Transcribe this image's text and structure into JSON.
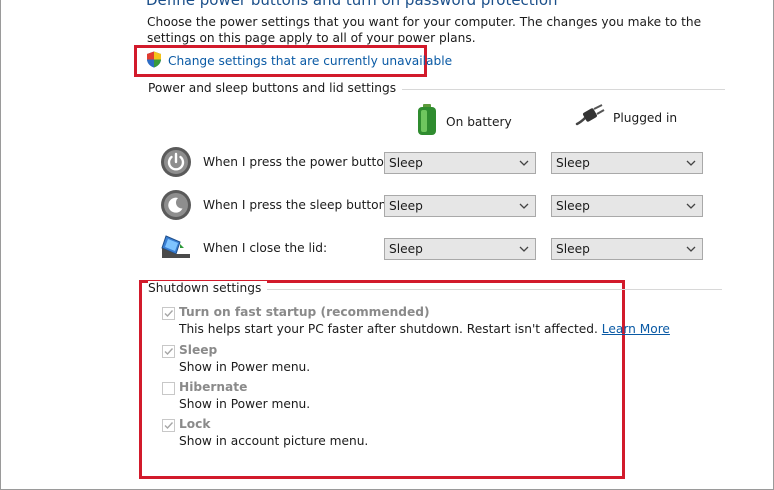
{
  "header": {
    "heading_partial": "Define power buttons and turn on password protection",
    "description": "Choose the power settings that you want for your computer. The changes you make to the settings on this page apply to all of your power plans.",
    "change_link": "Change settings that are currently unavailable",
    "change_link_icon": "uac-shield-icon"
  },
  "power_section": {
    "label": "Power and sleep buttons and lid settings",
    "columns": [
      {
        "label": "On battery",
        "icon": "battery-icon"
      },
      {
        "label": "Plugged in",
        "icon": "plug-icon"
      }
    ],
    "rows": [
      {
        "label": "When I press the power button:",
        "icon": "power-button-icon",
        "battery": "Sleep",
        "plugged": "Sleep"
      },
      {
        "label": "When I press the sleep button:",
        "icon": "sleep-button-icon",
        "battery": "Sleep",
        "plugged": "Sleep"
      },
      {
        "label": "When I close the lid:",
        "icon": "laptop-lid-icon",
        "battery": "Sleep",
        "plugged": "Sleep"
      }
    ]
  },
  "shutdown_section": {
    "label": "Shutdown settings",
    "options": [
      {
        "title": "Turn on fast startup (recommended)",
        "desc": "This helps start your PC faster after shutdown. Restart isn't affected.",
        "link": "Learn More",
        "checked": true
      },
      {
        "title": "Sleep",
        "desc": "Show in Power menu.",
        "checked": true
      },
      {
        "title": "Hibernate",
        "desc": "Show in Power menu.",
        "checked": false
      },
      {
        "title": "Lock",
        "desc": "Show in account picture menu.",
        "checked": true
      }
    ]
  },
  "colors": {
    "highlight": "#d21a2b",
    "link": "#0a5aa5",
    "disabled_text": "#8a8a8a"
  }
}
